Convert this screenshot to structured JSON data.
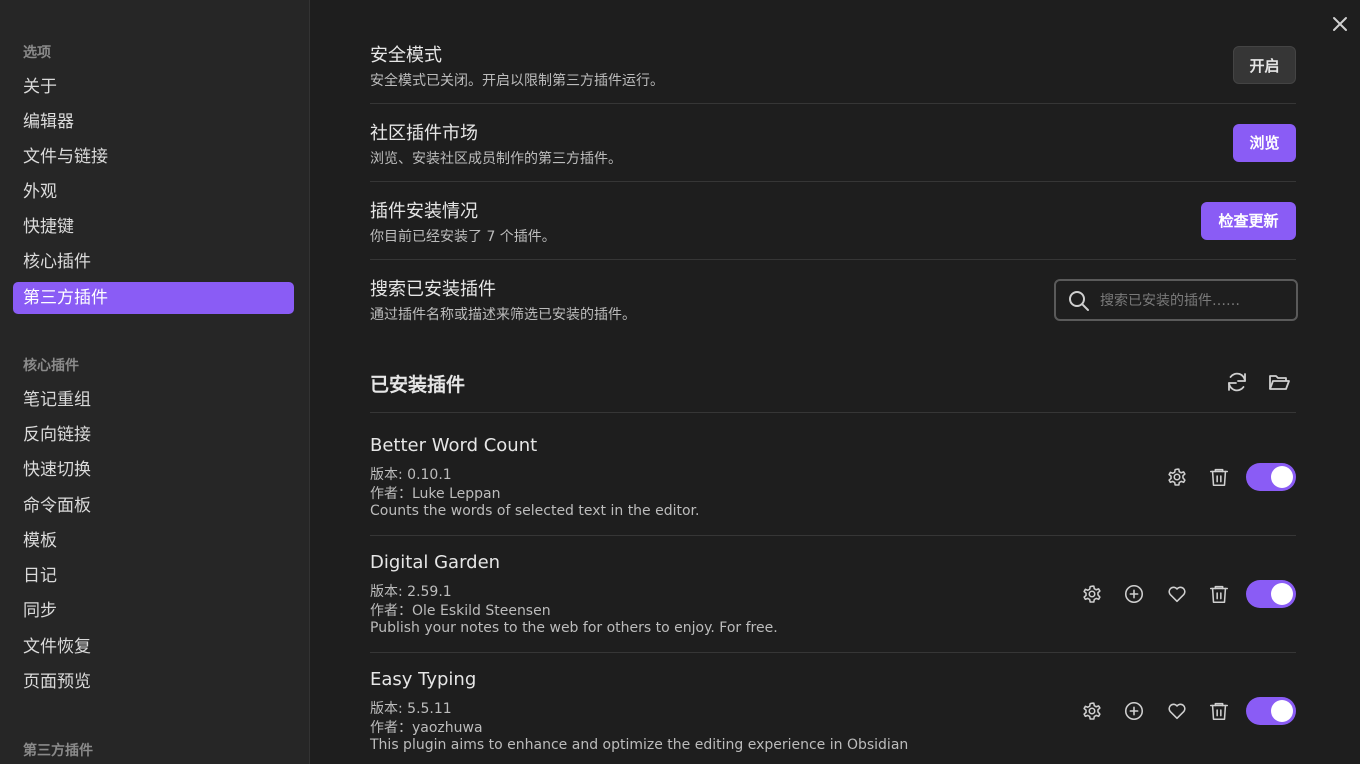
{
  "sidebar": {
    "options_heading": "选项",
    "options_items": [
      "关于",
      "编辑器",
      "文件与链接",
      "外观",
      "快捷键",
      "核心插件",
      "第三方插件"
    ],
    "active_item": "第三方插件",
    "core_heading": "核心插件",
    "core_items": [
      "笔记重组",
      "反向链接",
      "快速切换",
      "命令面板",
      "模板",
      "日记",
      "同步",
      "文件恢复",
      "页面预览"
    ],
    "third_heading": "第三方插件"
  },
  "settings": {
    "safe_mode": {
      "title": "安全模式",
      "desc": "安全模式已关闭。开启以限制第三方插件运行。",
      "button": "开启"
    },
    "community": {
      "title": "社区插件市场",
      "desc": "浏览、安装社区成员制作的第三方插件。",
      "button": "浏览"
    },
    "status": {
      "title": "插件安装情况",
      "desc": "你目前已经安装了 7 个插件。",
      "button": "检查更新"
    },
    "search": {
      "title": "搜索已安装插件",
      "desc": "通过插件名称或描述来筛选已安装的插件。",
      "placeholder": "搜索已安装的插件……"
    }
  },
  "installed": {
    "title": "已安装插件",
    "plugins": [
      {
        "name": "Better Word Count",
        "version": "版本: 0.10.1",
        "author": "作者：Luke Leppan",
        "desc": "Counts the words of selected text in the editor.",
        "enabled": true
      },
      {
        "name": "Digital Garden",
        "version": "版本: 2.59.1",
        "author": "作者：Ole Eskild Steensen",
        "desc": "Publish your notes to the web for others to enjoy. For free.",
        "enabled": true
      },
      {
        "name": "Easy Typing",
        "version": "版本: 5.5.11",
        "author": "作者：yaozhuwa",
        "desc": "This plugin aims to enhance and optimize the editing experience in Obsidian",
        "enabled": true
      }
    ]
  },
  "colors": {
    "accent": "#8a5cf5",
    "background": "#1e1e1e",
    "sidebar": "#262626"
  },
  "icons": [
    "close-icon",
    "search-icon",
    "reload-icon",
    "folder-open-icon",
    "gear-icon",
    "plus-circle-icon",
    "heart-icon",
    "trash-icon"
  ]
}
